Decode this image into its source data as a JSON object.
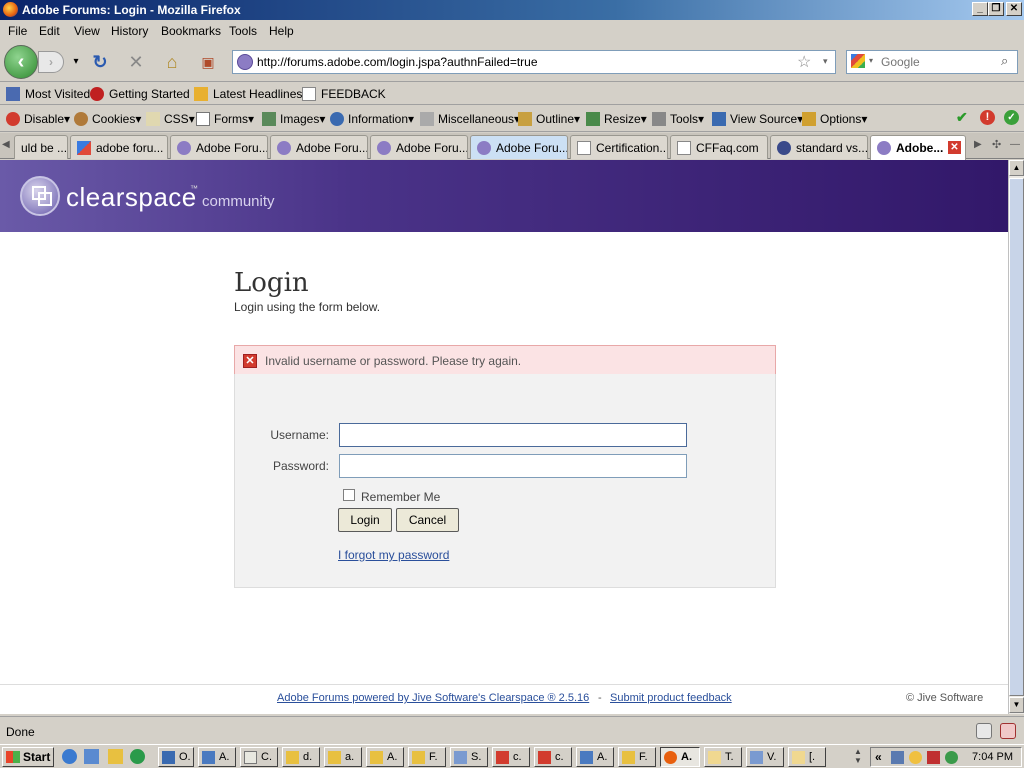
{
  "window": {
    "title": "Adobe Forums: Login - Mozilla Firefox",
    "buttons": [
      "_",
      "❐",
      "✕"
    ]
  },
  "menubar": [
    "File",
    "Edit",
    "View",
    "History",
    "Bookmarks",
    "Tools",
    "Help"
  ],
  "navbar": {
    "url": "http://forums.adobe.com/login.jspa?authnFailed=true",
    "search_placeholder": "Google"
  },
  "bookmarks": [
    "Most Visited",
    "Getting Started",
    "Latest Headlines",
    "FEEDBACK"
  ],
  "devtoolbar": [
    "Disable",
    "Cookies",
    "CSS",
    "Forms",
    "Images",
    "Information",
    "Miscellaneous",
    "Outline",
    "Resize",
    "Tools",
    "View Source",
    "Options"
  ],
  "tabs": [
    "uld be ...",
    "adobe foru...",
    "Adobe Foru...",
    "Adobe Foru...",
    "Adobe Foru...",
    "Adobe Foru...",
    "Certification...",
    "CFFaq.com",
    "standard vs...",
    "Adobe..."
  ],
  "page": {
    "brand": "clearspace",
    "brand_tm": "™",
    "brand_sub": "community",
    "title": "Login",
    "subtitle": "Login using the form below.",
    "error": "Invalid username or password. Please try again.",
    "username_label": "Username:",
    "password_label": "Password:",
    "remember_label": "Remember Me",
    "login_button": "Login",
    "cancel_button": "Cancel",
    "forgot_link": "I forgot my password",
    "footer_main": "Adobe Forums powered by Jive Software's Clearspace ® 2.5.16",
    "footer_sep": "-",
    "footer_feedback": "Submit product feedback",
    "footer_copy": "© Jive Software"
  },
  "statusbar": {
    "text": "Done"
  },
  "taskbar": {
    "start": "Start",
    "tasks": [
      "O.",
      "A.",
      "C.",
      "d.",
      "a.",
      "A.",
      "F.",
      "S.",
      "c.",
      "c.",
      "A.",
      "F.",
      "A.",
      "T.",
      "V.",
      "[."
    ],
    "clock": "7:04 PM"
  }
}
